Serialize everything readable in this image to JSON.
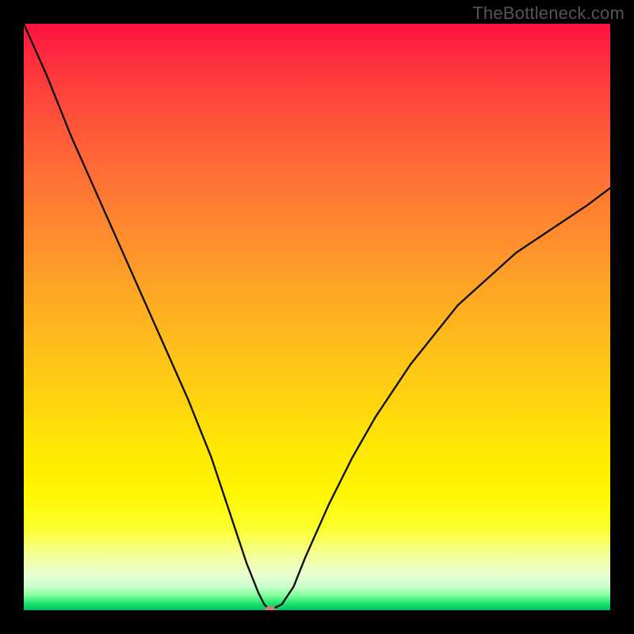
{
  "watermark": "TheBottleneck.com",
  "chart_data": {
    "type": "line",
    "title": "",
    "xlabel": "",
    "ylabel": "",
    "xlim": [
      0,
      100
    ],
    "ylim": [
      0,
      100
    ],
    "grid": false,
    "legend": false,
    "background": "vertical-gradient",
    "gradient_stops": [
      {
        "pos": 0,
        "color": "#ff113f"
      },
      {
        "pos": 24,
        "color": "#ff6a36"
      },
      {
        "pos": 54,
        "color": "#ffbc1c"
      },
      {
        "pos": 80,
        "color": "#fff600"
      },
      {
        "pos": 96,
        "color": "#c9ffcd"
      },
      {
        "pos": 100,
        "color": "#03c05d"
      }
    ],
    "series": [
      {
        "name": "bottleneck-curve",
        "color": "#111111",
        "x": [
          0,
          4,
          8,
          12,
          16,
          20,
          24,
          28,
          32,
          36,
          38,
          40,
          41,
          42,
          44,
          46,
          48,
          52,
          56,
          60,
          66,
          74,
          84,
          96,
          100
        ],
        "values": [
          100,
          91,
          81,
          72,
          63,
          54,
          45,
          36,
          26,
          14,
          8,
          3,
          1,
          0,
          1,
          4,
          9,
          18,
          26,
          33,
          42,
          52,
          61,
          69,
          72
        ]
      }
    ],
    "marker": {
      "x": 42,
      "y": 0,
      "color": "#d17b7e",
      "shape": "capsule"
    }
  }
}
